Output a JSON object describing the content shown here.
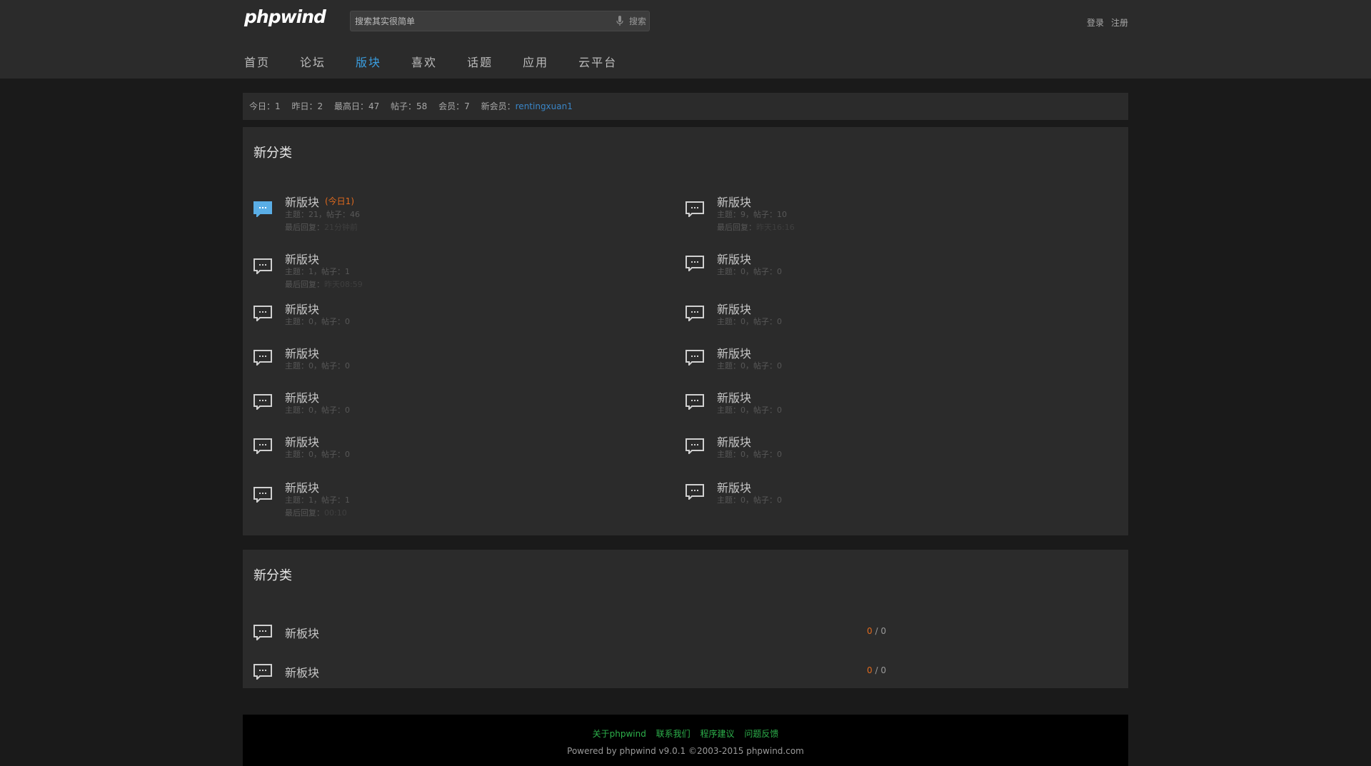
{
  "header": {
    "logo": "phpwind",
    "search": {
      "placeholder": "搜索其实很简单",
      "button": "搜索"
    },
    "login": "登录",
    "register": "注册",
    "nav": [
      "首页",
      "论坛",
      "版块",
      "喜欢",
      "话题",
      "应用",
      "云平台"
    ],
    "nav_active_index": 2
  },
  "stats": {
    "today": "今日：1",
    "yesterday": "昨日：2",
    "max_day": "最高日：47",
    "posts": "帖子：58",
    "members": "会员：7",
    "new_member_label": "新会员：",
    "new_member": "rentingxuan1"
  },
  "category1": {
    "title": "新分类",
    "left": [
      {
        "name": "新版块",
        "today": "(今日1)",
        "meta": "主题：21，帖子：46",
        "last_label": "最后回复：",
        "last": "21分钟前",
        "highlight": true
      },
      {
        "name": "新版块",
        "meta": "主题：1，帖子：1",
        "last_label": "最后回复：",
        "last": "昨天08:59"
      },
      {
        "name": "新版块",
        "meta": "主题：0，帖子：0"
      },
      {
        "name": "新版块",
        "meta": "主题：0，帖子：0"
      },
      {
        "name": "新版块",
        "meta": "主题：0，帖子：0"
      },
      {
        "name": "新版块",
        "meta": "主题：0，帖子：0"
      },
      {
        "name": "新版块",
        "meta": "主题：1，帖子：1",
        "last_label": "最后回复：",
        "last": "00:10"
      }
    ],
    "right": [
      {
        "name": "新版块",
        "meta": "主题：9，帖子：10",
        "last_label": "最后回复：",
        "last": "昨天16:16"
      },
      {
        "name": "新版块",
        "meta": "主题：0，帖子：0"
      },
      {
        "name": "新版块",
        "meta": "主题：0，帖子：0"
      },
      {
        "name": "新版块",
        "meta": "主题：0，帖子：0"
      },
      {
        "name": "新版块",
        "meta": "主题：0，帖子：0"
      },
      {
        "name": "新版块",
        "meta": "主题：0，帖子：0"
      },
      {
        "name": "新版块",
        "meta": "主题：0，帖子：0"
      }
    ]
  },
  "category2": {
    "title": "新分类",
    "rows": [
      {
        "name": "新板块",
        "count_a": "0",
        "sep": " / ",
        "count_b": "0"
      },
      {
        "name": "新板块",
        "count_a": "0",
        "sep": " / ",
        "count_b": "0"
      }
    ]
  },
  "footer": {
    "links": [
      "关于phpwind",
      "联系我们",
      "程序建议",
      "问题反馈"
    ],
    "copyright": "Powered by phpwind v9.0.1 ©2003-2015 phpwind.com"
  },
  "colors": {
    "accent": "#3a9ee0",
    "today_orange": "#e06a1e",
    "footer_link_green": "#2db04b",
    "icon_highlight": "#5aaee6"
  }
}
